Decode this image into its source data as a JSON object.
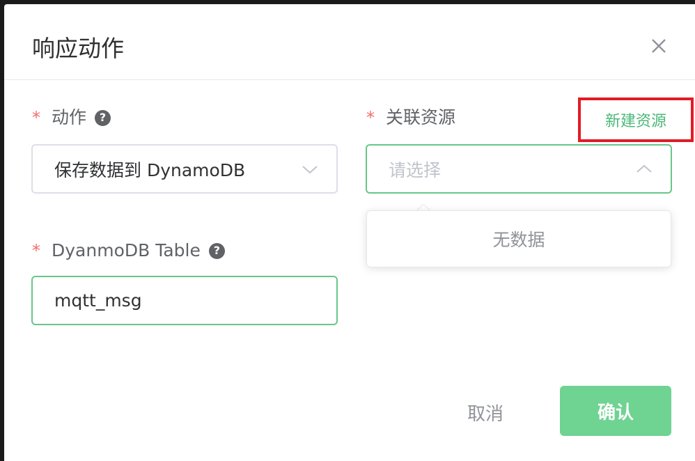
{
  "dialog": {
    "title": "响应动作",
    "close_icon": "close-icon"
  },
  "form": {
    "action": {
      "required_mark": "*",
      "label": "动作",
      "help_icon": "question-circle-icon",
      "value": "保存数据到 DynamoDB"
    },
    "resource": {
      "required_mark": "*",
      "label": "关联资源",
      "new_link": "新建资源",
      "placeholder": "请选择",
      "empty_text": "无数据"
    },
    "table": {
      "required_mark": "*",
      "label": "DyanmoDB Table",
      "help_icon": "question-circle-icon",
      "value": "mqtt_msg"
    }
  },
  "footer": {
    "cancel_label": "取消",
    "confirm_label": "确认"
  },
  "colors": {
    "accent": "#67c689",
    "required": "#f56c6c",
    "highlight_box": "#e21b24",
    "confirm_bg": "#6fd392"
  }
}
